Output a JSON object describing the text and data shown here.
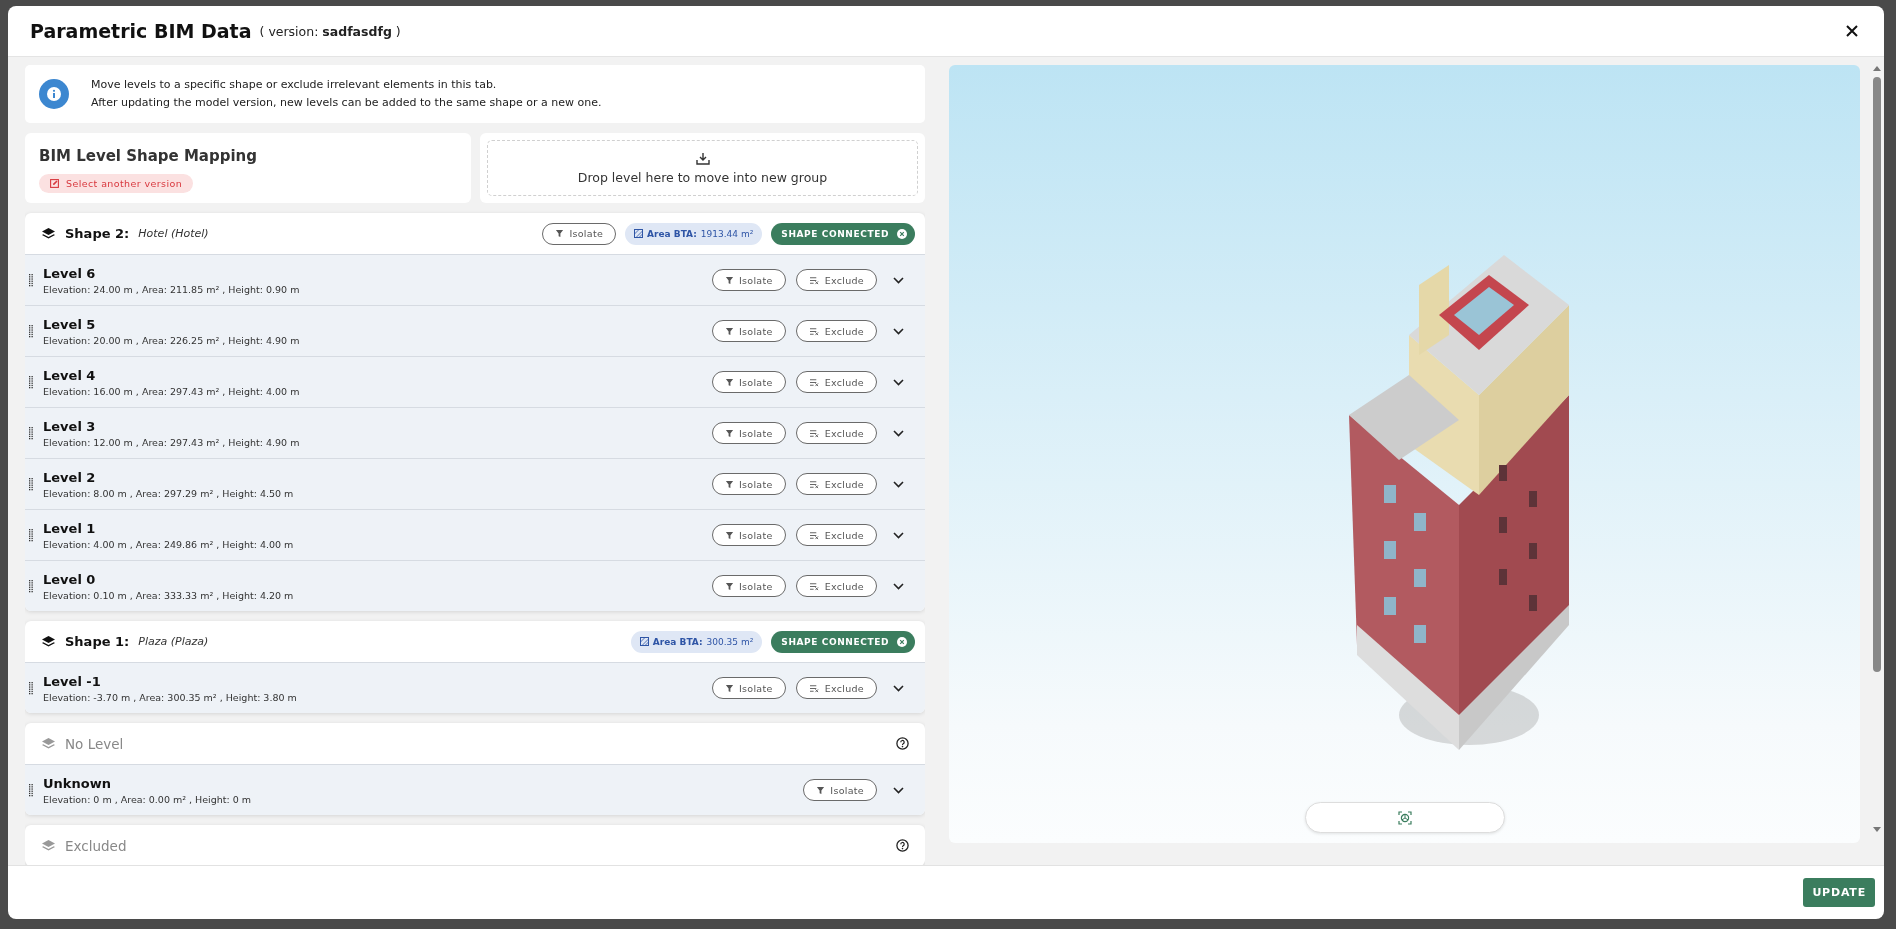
{
  "dialog": {
    "title": "Parametric BIM Data",
    "version": "( version: **sadfasdfg** )"
  },
  "info": {
    "lines": [
      "Move levels to a specific shape or exclude irrelevant elements in this tab.",
      "After updating the model version, new levels can be added to the same shape or a new one."
    ]
  },
  "mapping": {
    "title": "BIM Level Shape Mapping",
    "select_version": "Select another version"
  },
  "drop_zone": {
    "text": "Drop level here to move into new group"
  },
  "groups": [
    {
      "kind": "shape",
      "label": "Shape 2:",
      "name": "Hotel (Hotel)",
      "isolate": "Isolate",
      "area_label": "Area BTA:",
      "area": "1913.44 m²",
      "status": "SHAPE CONNECTED",
      "levels": [
        {
          "name": "Level 6",
          "details": "Elevation: 24.00 m , Area: 211.85 m² , Height: 0.90 m",
          "isolate": "Isolate",
          "exclude": "Exclude"
        },
        {
          "name": "Level 5",
          "details": "Elevation: 20.00 m , Area: 226.25 m² , Height: 4.90 m",
          "isolate": "Isolate",
          "exclude": "Exclude"
        },
        {
          "name": "Level 4",
          "details": "Elevation: 16.00 m , Area: 297.43 m² , Height: 4.00 m",
          "isolate": "Isolate",
          "exclude": "Exclude"
        },
        {
          "name": "Level 3",
          "details": "Elevation: 12.00 m , Area: 297.43 m² , Height: 4.90 m",
          "isolate": "Isolate",
          "exclude": "Exclude"
        },
        {
          "name": "Level 2",
          "details": "Elevation: 8.00 m , Area: 297.29 m² , Height: 4.50 m",
          "isolate": "Isolate",
          "exclude": "Exclude"
        },
        {
          "name": "Level 1",
          "details": "Elevation: 4.00 m , Area: 249.86 m² , Height: 4.00 m",
          "isolate": "Isolate",
          "exclude": "Exclude"
        },
        {
          "name": "Level 0",
          "details": "Elevation: 0.10 m , Area: 333.33 m² , Height: 4.20 m",
          "isolate": "Isolate",
          "exclude": "Exclude"
        }
      ]
    },
    {
      "kind": "shape",
      "label": "Shape 1:",
      "name": "Plaza (Plaza)",
      "area_label": "Area BTA:",
      "area": "300.35 m²",
      "status": "SHAPE CONNECTED",
      "levels": [
        {
          "name": "Level -1",
          "details": "Elevation: -3.70 m , Area: 300.35 m² , Height: 3.80 m",
          "isolate": "Isolate",
          "exclude": "Exclude"
        }
      ]
    },
    {
      "kind": "other",
      "label": "No Level",
      "levels": [
        {
          "name": "Unknown",
          "details": "Elevation: 0 m , Area: 0.00 m² , Height: 0 m",
          "isolate": "Isolate"
        }
      ]
    },
    {
      "kind": "other",
      "label": "Excluded"
    }
  ],
  "footer": {
    "update": "UPDATE"
  }
}
